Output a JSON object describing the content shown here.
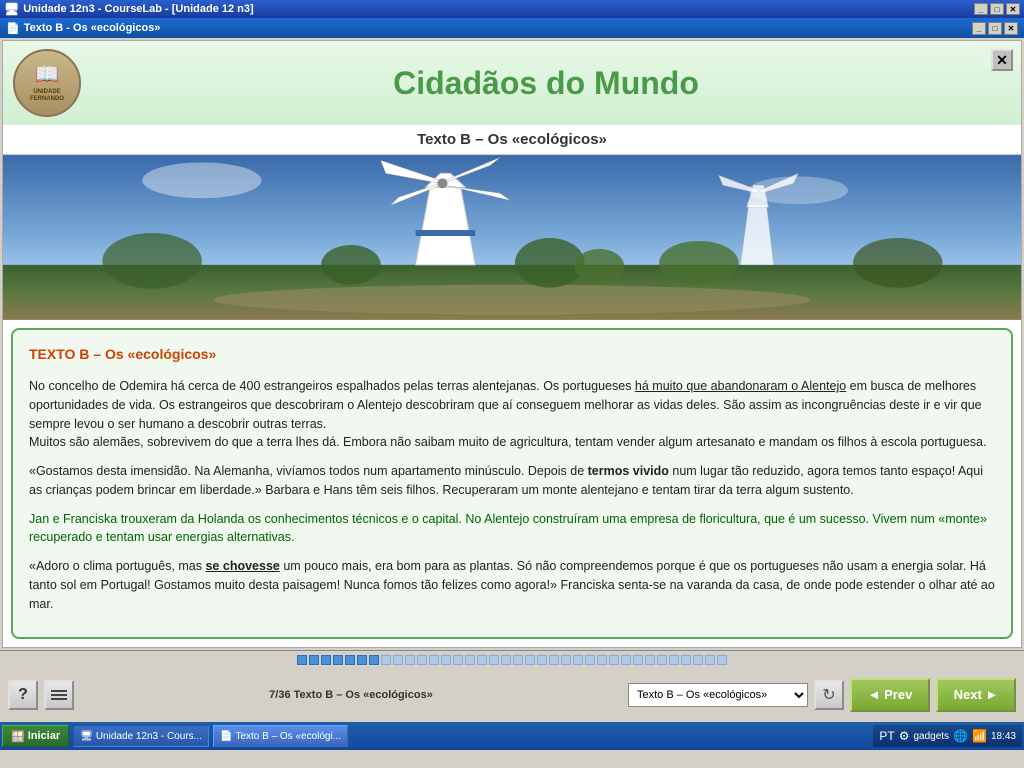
{
  "window": {
    "title": "Unidade 12n3 - CourseLab - [Unidade 12 n3]",
    "inner_title": "Texto B - Os «ecológicos»"
  },
  "header": {
    "logo_text": "UNIDADE FERNANDO",
    "title": "Cidadãos do Mundo",
    "close_symbol": "✕"
  },
  "subtitle": "Texto B – Os «ecológicos»",
  "text": {
    "heading": "TEXTO B – ",
    "heading_colored": "Os «ecológicos»",
    "para1": "No concelho de Odemira há cerca de 400 estrangeiros espalhados pelas terras alentejanas. Os portugueses há muito que abandonaram o Alentejo em busca de melhores oportunidades de vida. Os estrangeiros que descobriram o Alentejo descobriram que aí conseguem melhorar as vidas deles. São assim as incongruências deste ir e vir que sempre levou o ser humano a descobrir outras terras. Muitos são alemães, sobrevivem do que a terra lhes dá. Embora não saibam muito de agricultura, tentam vender algum artesanato e mandam os filhos à escola portuguesa.",
    "para2": "«Gostamos desta imensidão. Na Alemanha, vivíamos todos num apartamento minúsculo. Depois de termos vivido num lugar tão reduzido, agora temos tanto espaço! Aqui as crianças podem brincar em liberdade.» Barbara e Hans têm seis filhos. Recuperaram um monte alentejano e tentam tirar da terra algum sustento.",
    "para3": "Jan e Franciska trouxeram da Holanda os conhecimentos técnicos e o capital. No Alentejo construíram uma empresa de floricultura, que é um sucesso. Vivem num «monte» recuperado e tentam usar energias alternativas.",
    "para4": "«Adoro o clima português, mas se chovesse um pouco mais, era bom para as plantas. Só não compreendemos porque é que os portugueses não usam a energia solar. Há tanto sol em Portugal! Gostamos muito desta paisagem! Nunca fomos tão felizes como agora!» Franciska senta-se na varanda da casa, de onde pode estender o olhar até ao mar."
  },
  "navigation": {
    "help_label": "?",
    "page_info": "7/36 Texto B – Os «ecológicos»",
    "dropdown_value": "Texto B – Os «ecológicos»",
    "prev_label": "◄ Prev",
    "next_label": "Next ►",
    "refresh_symbol": "↻"
  },
  "taskbar": {
    "start_label": "Iniciar",
    "items": [
      {
        "label": "Unidade 12n3 - Cours...",
        "active": false
      },
      {
        "label": "Texto B – Os «ecológi...",
        "active": true
      }
    ],
    "tray": {
      "lang": "PT",
      "time": "18:43"
    }
  },
  "progress": {
    "total": 36,
    "current": 7
  }
}
